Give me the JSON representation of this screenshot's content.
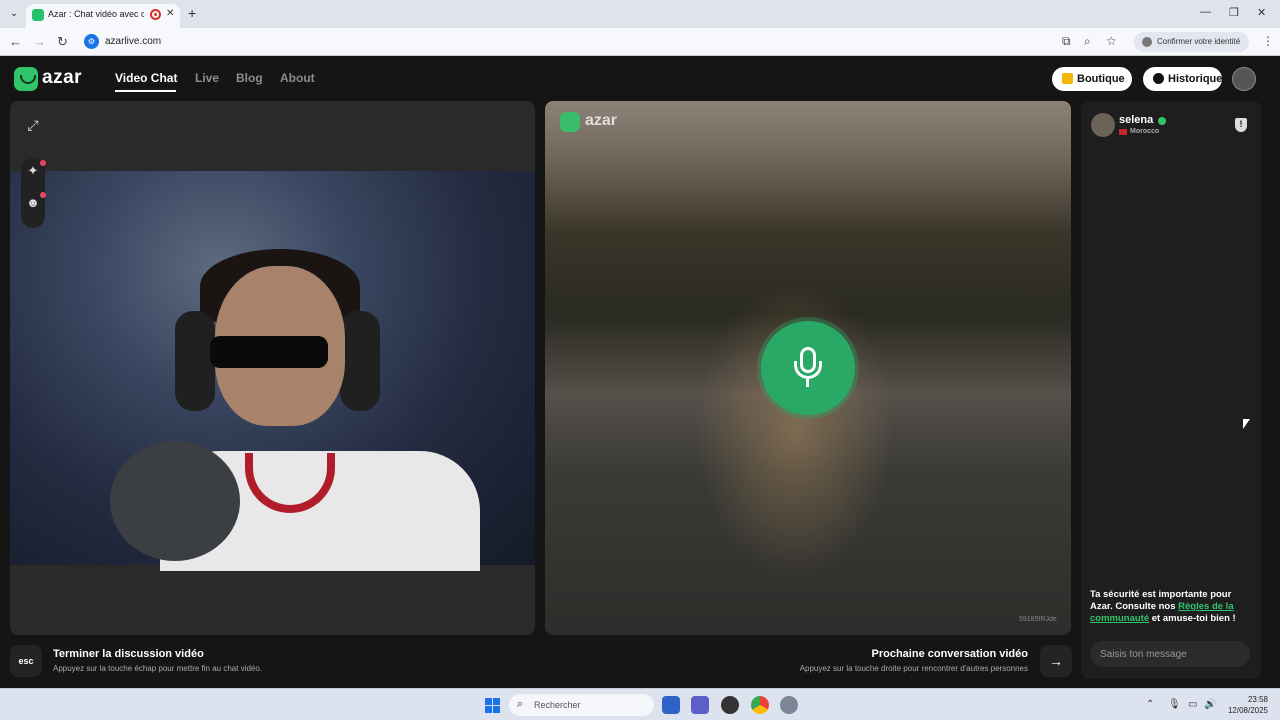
{
  "browser": {
    "tab_title": "Azar : Chat vidéo avec de n",
    "url": "azarlive.com",
    "identity_button": "Confirmer votre identité"
  },
  "header": {
    "logo": "azar",
    "nav": [
      {
        "label": "Video Chat",
        "active": true
      },
      {
        "label": "Live",
        "active": false
      },
      {
        "label": "Blog",
        "active": false
      },
      {
        "label": "About",
        "active": false
      }
    ],
    "shop_label": "Boutique",
    "history_label": "Historique"
  },
  "video": {
    "remote_logo": "azar",
    "watermark": "59185fRJde"
  },
  "peer": {
    "name": "selena",
    "country": "Morocco"
  },
  "chat": {
    "safety_prefix": "Ta sécurité est importante pour Azar. Consulte nos ",
    "safety_link": "Règles de la communauté",
    "safety_suffix": " et amuse-toi bien !",
    "input_placeholder": "Saisis ton message"
  },
  "footer": {
    "esc_key": "esc",
    "end_title": "Terminer la discussion vidéo",
    "end_sub": "Appuyez sur la touche échap pour mettre fin au chat vidéo.",
    "next_title": "Prochaine conversation vidéo",
    "next_sub": "Appuyez sur la touche droite pour rencontrer d'autres personnes"
  },
  "taskbar": {
    "search_placeholder": "Rechercher",
    "time": "23:58",
    "date": "12/08/2025"
  },
  "colors": {
    "brand_green": "#31c46a",
    "mic_green": "#2aa866"
  }
}
